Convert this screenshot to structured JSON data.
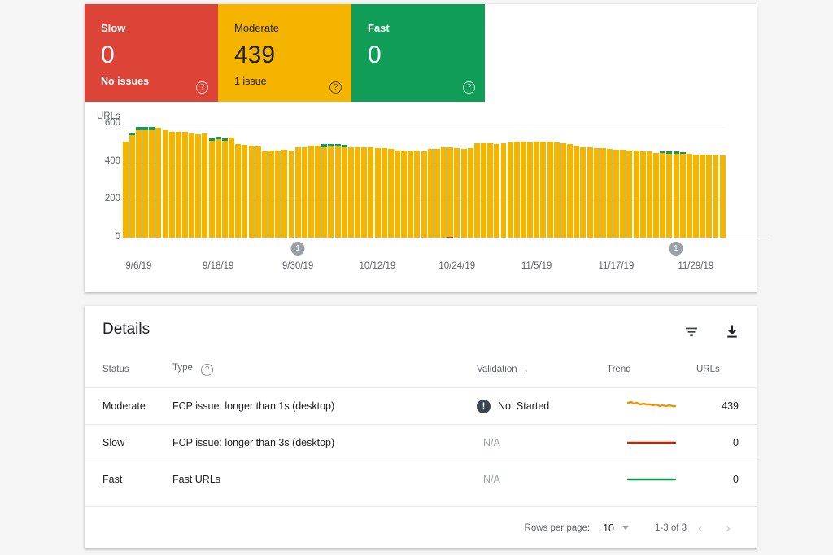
{
  "summary_cards": [
    {
      "title": "Slow",
      "count": "0",
      "sub": "No issues",
      "color": "#db4437",
      "help": "?"
    },
    {
      "title": "Moderate",
      "count": "439",
      "sub": "1 issue",
      "color": "#f4b400",
      "help": "?"
    },
    {
      "title": "Fast",
      "count": "0",
      "sub": "",
      "color": "#0f9d58",
      "help": "?"
    }
  ],
  "chart_data": {
    "type": "bar",
    "title": "",
    "ylabel": "URLs",
    "xlabel": "",
    "ylim": [
      0,
      600
    ],
    "yticks": [
      "0",
      "200",
      "400",
      "600"
    ],
    "grid": true,
    "legend_position": "none",
    "stacked": true,
    "xtick_labels": [
      "9/6/19",
      "9/18/19",
      "9/30/19",
      "10/12/19",
      "10/24/19",
      "11/5/19",
      "11/17/19",
      "11/29/19"
    ],
    "xtick_indices": [
      2,
      14,
      26,
      38,
      50,
      62,
      74,
      86
    ],
    "annotations": [
      {
        "label": "1",
        "index": 26
      },
      {
        "label": "1",
        "index": 83
      }
    ],
    "series": [
      {
        "name": "Slow",
        "color": "#db4437",
        "values": [
          0,
          0,
          0,
          0,
          0,
          0,
          0,
          0,
          0,
          0,
          0,
          0,
          0,
          0,
          0,
          0,
          0,
          0,
          0,
          0,
          0,
          0,
          3,
          4,
          5,
          2,
          0,
          0,
          0,
          0,
          0,
          0,
          0,
          0,
          0,
          0,
          0,
          0,
          0,
          0,
          0,
          0,
          0,
          0,
          2,
          3,
          0,
          0,
          6,
          7,
          5,
          0,
          0,
          0,
          0,
          0,
          0,
          0,
          0,
          0,
          0,
          0,
          0,
          0,
          0,
          0,
          0,
          0,
          0,
          0,
          0,
          0,
          0,
          0,
          0,
          0,
          0,
          0,
          0,
          0,
          0,
          0,
          0,
          0,
          0,
          0,
          0,
          0,
          0,
          0,
          0
        ]
      },
      {
        "name": "Moderate",
        "color": "#f4b400",
        "values": [
          508,
          545,
          568,
          570,
          570,
          585,
          568,
          562,
          560,
          562,
          552,
          550,
          554,
          515,
          521,
          516,
          530,
          497,
          493,
          488,
          483,
          460,
          458,
          458,
          460,
          458,
          482,
          482,
          490,
          488,
          482,
          483,
          483,
          480,
          478,
          482,
          480,
          478,
          476,
          474,
          470,
          465,
          462,
          460,
          458,
          455,
          470,
          472,
          474,
          472,
          470,
          472,
          474,
          500,
          502,
          500,
          498,
          502,
          505,
          510,
          508,
          506,
          508,
          510,
          508,
          505,
          500,
          498,
          490,
          482,
          478,
          476,
          474,
          470,
          468,
          466,
          464,
          462,
          460,
          458,
          450,
          448,
          446,
          446,
          444,
          444,
          442,
          440,
          440,
          440,
          438
        ]
      },
      {
        "name": "Fast",
        "color": "#0f9d58",
        "values": [
          0,
          14,
          18,
          16,
          16,
          0,
          0,
          0,
          0,
          0,
          0,
          0,
          0,
          14,
          14,
          13,
          0,
          0,
          0,
          0,
          0,
          0,
          0,
          0,
          0,
          0,
          0,
          0,
          0,
          0,
          14,
          13,
          13,
          13,
          0,
          0,
          0,
          0,
          0,
          0,
          0,
          0,
          0,
          0,
          0,
          0,
          0,
          0,
          0,
          0,
          0,
          0,
          0,
          0,
          0,
          0,
          0,
          0,
          0,
          0,
          0,
          0,
          0,
          0,
          0,
          0,
          0,
          0,
          0,
          0,
          0,
          0,
          0,
          0,
          0,
          0,
          0,
          0,
          0,
          0,
          0,
          12,
          12,
          12,
          11,
          0,
          0,
          0,
          0,
          0,
          0
        ]
      }
    ]
  },
  "details": {
    "title": "Details",
    "filter_icon": "filter-icon",
    "download_icon": "download-icon",
    "columns": {
      "status": "Status",
      "type": "Type",
      "type_help": "?",
      "validation": "Validation",
      "validation_sort": "↓",
      "trend": "Trend",
      "urls": "URLs"
    },
    "rows": [
      {
        "status": "Moderate",
        "type": "FCP issue: longer than 1s (desktop)",
        "validation": "Not Started",
        "validation_icon": "exclamation-icon",
        "trend_color": "#f09300",
        "trend_kind": "wavy",
        "urls": "439"
      },
      {
        "status": "Slow",
        "type": "FCP issue: longer than 3s (desktop)",
        "validation": "N/A",
        "validation_icon": "",
        "trend_color": "#cc2200",
        "trend_kind": "flat",
        "urls": "0"
      },
      {
        "status": "Fast",
        "type": "Fast URLs",
        "validation": "N/A",
        "validation_icon": "",
        "trend_color": "#0f8a4a",
        "trend_kind": "flat",
        "urls": "0"
      }
    ],
    "pagination": {
      "rows_per_page_label": "Rows per page:",
      "rows_per_page_value": "10",
      "range": "1-3 of 3",
      "prev": "‹",
      "next": "›"
    }
  }
}
